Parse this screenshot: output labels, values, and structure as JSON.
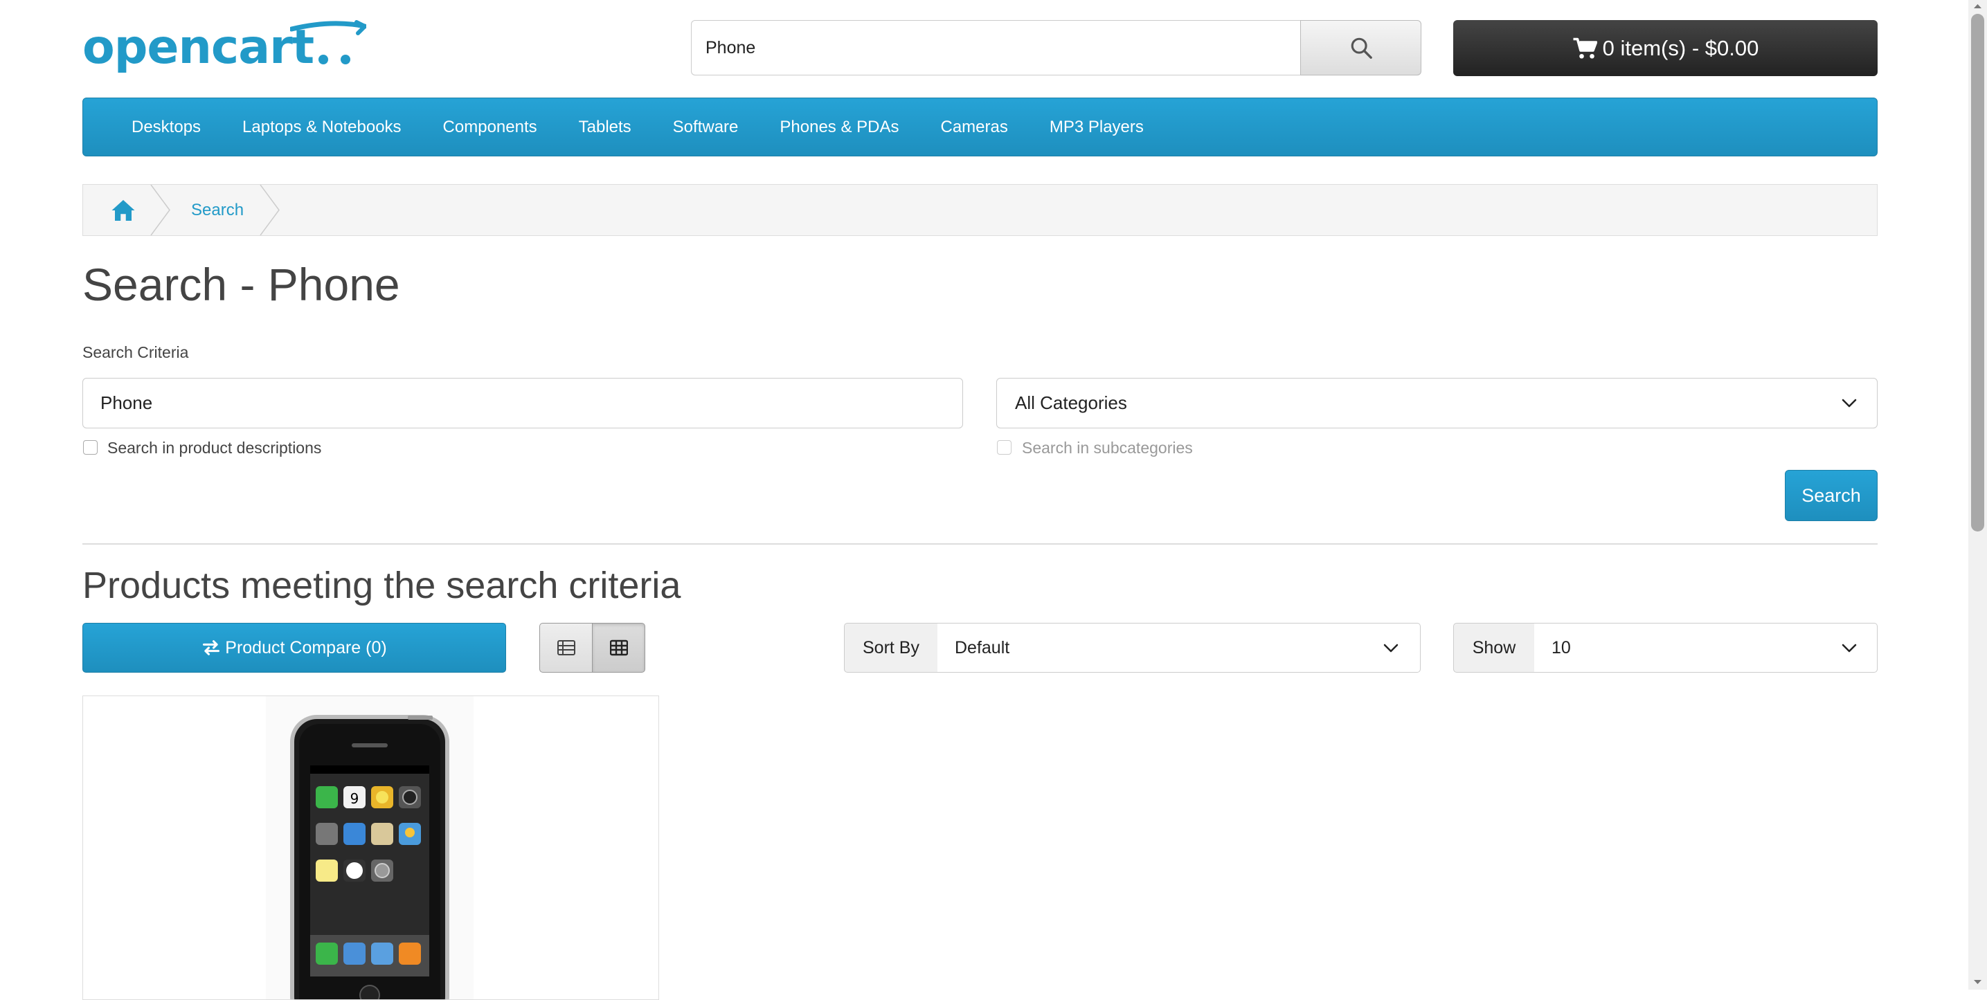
{
  "header": {
    "logo_text": "opencart",
    "search_value": "Phone",
    "cart_label": "0 item(s) - $0.00"
  },
  "nav": {
    "items": [
      "Desktops",
      "Laptops & Notebooks",
      "Components",
      "Tablets",
      "Software",
      "Phones & PDAs",
      "Cameras",
      "MP3 Players"
    ]
  },
  "breadcrumb": {
    "items": [
      "Search"
    ]
  },
  "page": {
    "title": "Search - Phone",
    "criteria_label": "Search Criteria",
    "search_field_value": "Phone",
    "category_selected": "All Categories",
    "search_descriptions_label": "Search in product descriptions",
    "search_subcategories_label": "Search in subcategories",
    "search_button": "Search"
  },
  "results": {
    "heading": "Products meeting the search criteria",
    "compare_label": "Product Compare (0)",
    "sort_label": "Sort By",
    "sort_value": "Default",
    "show_label": "Show",
    "show_value": "10"
  },
  "colors": {
    "brand_blue": "#229ac8",
    "cart_dark": "#222222"
  }
}
